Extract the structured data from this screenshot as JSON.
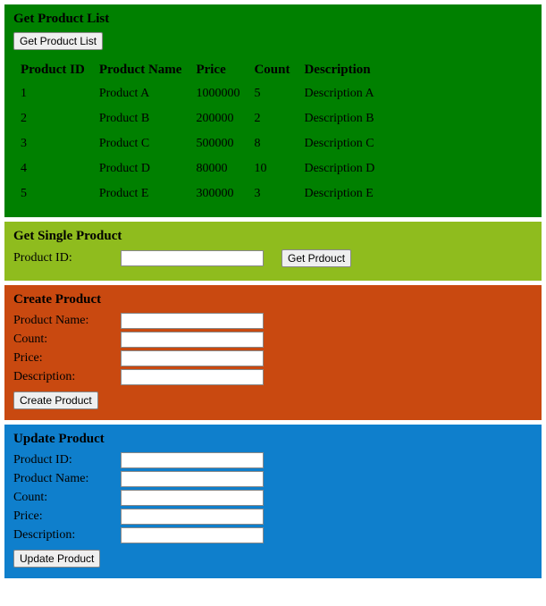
{
  "getList": {
    "title": "Get Product List",
    "buttonLabel": "Get Product List",
    "headers": {
      "id": "Product ID",
      "name": "Product Name",
      "price": "Price",
      "count": "Count",
      "desc": "Description"
    },
    "rows": [
      {
        "id": "1",
        "name": "Product A",
        "price": "1000000",
        "count": "5",
        "desc": "Description A"
      },
      {
        "id": "2",
        "name": "Product B",
        "price": "200000",
        "count": "2",
        "desc": "Description B"
      },
      {
        "id": "3",
        "name": "Product C",
        "price": "500000",
        "count": "8",
        "desc": "Description C"
      },
      {
        "id": "4",
        "name": "Product D",
        "price": "80000",
        "count": "10",
        "desc": "Description D"
      },
      {
        "id": "5",
        "name": "Product E",
        "price": "300000",
        "count": "3",
        "desc": "Description E"
      }
    ]
  },
  "getSingle": {
    "title": "Get Single Product",
    "idLabel": "Product ID:",
    "idValue": "",
    "buttonLabel": "Get Prdouct"
  },
  "create": {
    "title": "Create Product",
    "nameLabel": "Product Name:",
    "nameValue": "",
    "countLabel": "Count:",
    "countValue": "",
    "priceLabel": "Price:",
    "priceValue": "",
    "descLabel": "Description:",
    "descValue": "",
    "buttonLabel": "Create Product"
  },
  "update": {
    "title": "Update Product",
    "idLabel": "Product ID:",
    "idValue": "",
    "nameLabel": "Product Name:",
    "nameValue": "",
    "countLabel": "Count:",
    "countValue": "",
    "priceLabel": "Price:",
    "priceValue": "",
    "descLabel": "Description:",
    "descValue": "",
    "buttonLabel": "Update Product"
  }
}
